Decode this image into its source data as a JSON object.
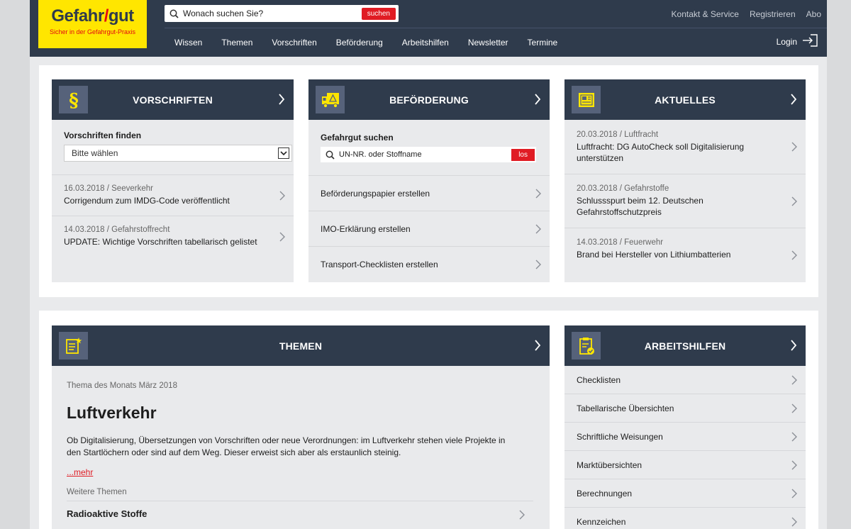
{
  "header": {
    "logo_title_a": "Gefahr",
    "logo_title_slash": "/",
    "logo_title_b": "gut",
    "logo_subtitle": "Sicher in der Gefahrgut-Praxis",
    "search_placeholder": "Wonach suchen Sie?",
    "search_button": "suchen",
    "top_links": [
      "Kontakt & Service",
      "Registrieren",
      "Abo"
    ],
    "nav": [
      "Wissen",
      "Themen",
      "Vorschriften",
      "Beförderung",
      "Arbeitshilfen",
      "Newsletter",
      "Termine"
    ],
    "login": "Login"
  },
  "vorschriften": {
    "title": "VORSCHRIFTEN",
    "finder_label": "Vorschriften finden",
    "select_value": "Bitte wählen",
    "items": [
      {
        "meta": "16.03.2018 / Seeverkehr",
        "text": "Corrigendum zum IMDG-Code veröffentlicht"
      },
      {
        "meta": "14.03.2018 / Gefahrstoffrecht",
        "text": "UPDATE: Wichtige Vorschriften tabellarisch gelistet"
      }
    ]
  },
  "befoerderung": {
    "title": "BEFÖRDERUNG",
    "search_label": "Gefahrgut suchen",
    "search_placeholder": "UN-NR. oder Stoffname",
    "search_button": "los",
    "items": [
      "Beförderungspapier erstellen",
      "IMO-Erklärung erstellen",
      "Transport-Checklisten erstellen"
    ]
  },
  "aktuelles": {
    "title": "AKTUELLES",
    "items": [
      {
        "meta": "20.03.2018 / Luftfracht",
        "text": "Luftfracht: DG AutoCheck soll Digitalisierung unterstützen"
      },
      {
        "meta": "20.03.2018 / Gefahrstoffe",
        "text": "Schlussspurt beim 12. Deutschen Gefahrstoffschutzpreis"
      },
      {
        "meta": "14.03.2018 / Feuerwehr",
        "text": "Brand bei Hersteller von Lithiumbatterien"
      }
    ]
  },
  "themen": {
    "title": "THEMEN",
    "kicker": "Thema des Monats März 2018",
    "headline": "Luftverkehr",
    "body": "Ob Digitalisierung, Übersetzungen von Vorschriften oder neue Verordnungen: im Luftverkehr stehen viele Projekte in den Startlöchern oder sind auf dem Weg. Dieser erweist sich aber als erstaunlich steinig.",
    "more_link": "...mehr",
    "more_label": "Weitere Themen",
    "more_item": "Radioaktive Stoffe"
  },
  "arbeitshilfen": {
    "title": "ARBEITSHILFEN",
    "items": [
      "Checklisten",
      "Tabellarische Übersichten",
      "Schriftliche Weisungen",
      "Marktübersichten",
      "Berechnungen",
      "Kennzeichen"
    ]
  },
  "colors": {
    "header_bg": "#2f3b4c",
    "brand_yellow": "#ffe600",
    "accent_red": "#e01c24"
  }
}
